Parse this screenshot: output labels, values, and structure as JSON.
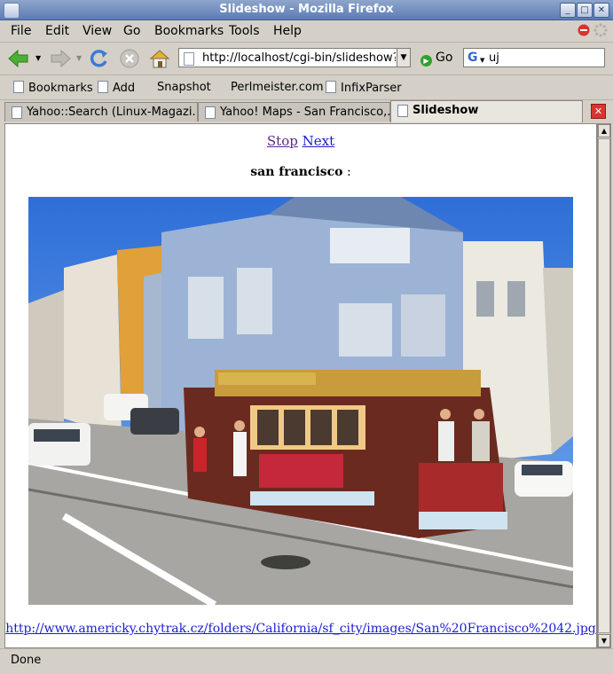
{
  "window": {
    "title": "Slideshow - Mozilla Firefox",
    "buttons": {
      "minimize": "_",
      "maximize": "□",
      "close": "✕"
    }
  },
  "menu": [
    "File",
    "Edit",
    "View",
    "Go",
    "Bookmarks",
    "Tools",
    "Help"
  ],
  "toolbar": {
    "url": "http://localhost/cgi-bin/slideshow?q=s",
    "go_label": "Go",
    "search_value": "uj",
    "icons": [
      "back-arrow-icon",
      "forward-arrow-icon",
      "reload-icon",
      "stop-icon",
      "home-icon"
    ]
  },
  "bookmarks": [
    "Bookmarks",
    "Add",
    "Snapshot",
    "Perlmeister.com",
    "InfixParser"
  ],
  "tabs": [
    {
      "label": "Yahoo::Search (Linux-Magazi..."
    },
    {
      "label": "Yahoo! Maps - San Francisco,..."
    },
    {
      "label": "Slideshow",
      "active": true
    }
  ],
  "page": {
    "links": {
      "stop": "Stop",
      "next": "Next"
    },
    "heading": "san francisco",
    "heading_suffix": " :",
    "image_url": "http://www.americky.chytrak.cz/folders/California/sf_city/images/San%20Francisco%2042.jpg"
  },
  "status": "Done",
  "colors": {
    "titlebar": "#5b7bb4",
    "link": "#1b1bd6",
    "visited": "#5a2a8a",
    "chrome": "#d4d0c8"
  }
}
